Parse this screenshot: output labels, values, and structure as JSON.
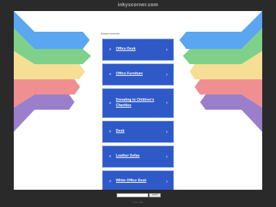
{
  "page": {
    "domain": "inkyscorner.com",
    "related_label": "Related searches",
    "links": [
      {
        "label": "Office Desk",
        "multi": false
      },
      {
        "label": "Office Furniture",
        "multi": false
      },
      {
        "label": "Donating to Children's Charities",
        "multi": true
      },
      {
        "label": "Desk",
        "multi": false
      },
      {
        "label": "Leather Sofas",
        "multi": false
      },
      {
        "label": "White Office Desk",
        "multi": false
      }
    ],
    "search_button": "Search",
    "footer": "Privacy Policy"
  },
  "colors": {
    "wing_blue": "#5aa6f0",
    "wing_green": "#7fd08a",
    "wing_yellow": "#f6df94",
    "wing_red": "#ef8f92",
    "wing_purple": "#9b7fcb",
    "link_bg": "#2f59c6"
  }
}
